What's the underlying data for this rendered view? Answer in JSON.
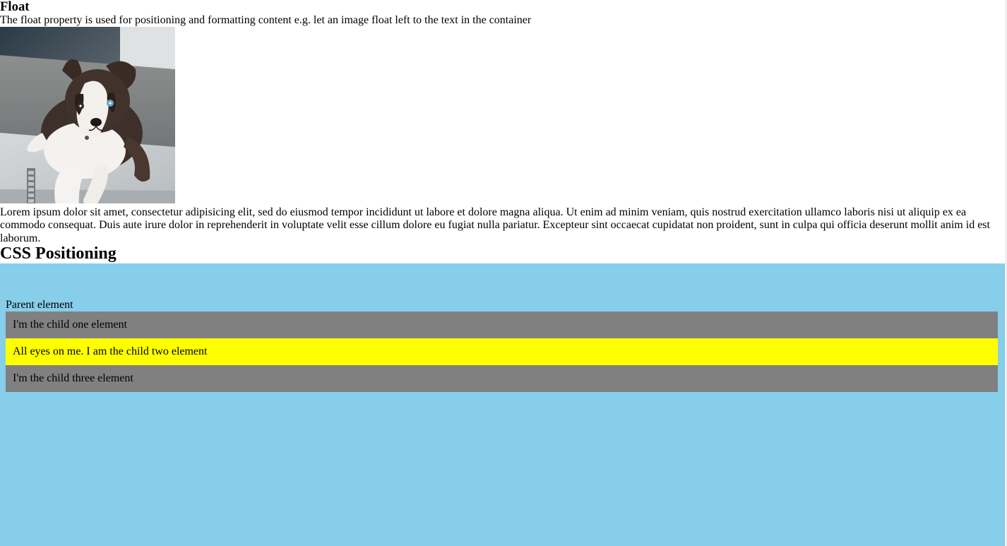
{
  "float_section": {
    "title": "Float",
    "description": "The float property is used for positioning and formatting content e.g. let an image float left to the text in the container",
    "image_icon": "puppy-photo",
    "paragraph": "Lorem ipsum dolor sit amet, consectetur adipisicing elit, sed do eiusmod tempor incididunt ut labore et dolore magna aliqua. Ut enim ad minim veniam, quis nostrud exercitation ullamco laboris nisi ut aliquip ex ea commodo consequat. Duis aute irure dolor in reprehenderit in voluptate velit esse cillum dolore eu fugiat nulla pariatur. Excepteur sint occaecat cupidatat non proident, sunt in culpa qui officia deserunt mollit anim id est laborum."
  },
  "positioning_section": {
    "title": "CSS Positioning",
    "parent_label": "Parent element",
    "children": [
      "I'm the child one element",
      "All eyes on me. I am the child two element",
      "I'm the child three element"
    ]
  },
  "colors": {
    "parent_bg": "#87ceeb",
    "child_gray": "#808080",
    "child_highlight": "#ffff00"
  }
}
